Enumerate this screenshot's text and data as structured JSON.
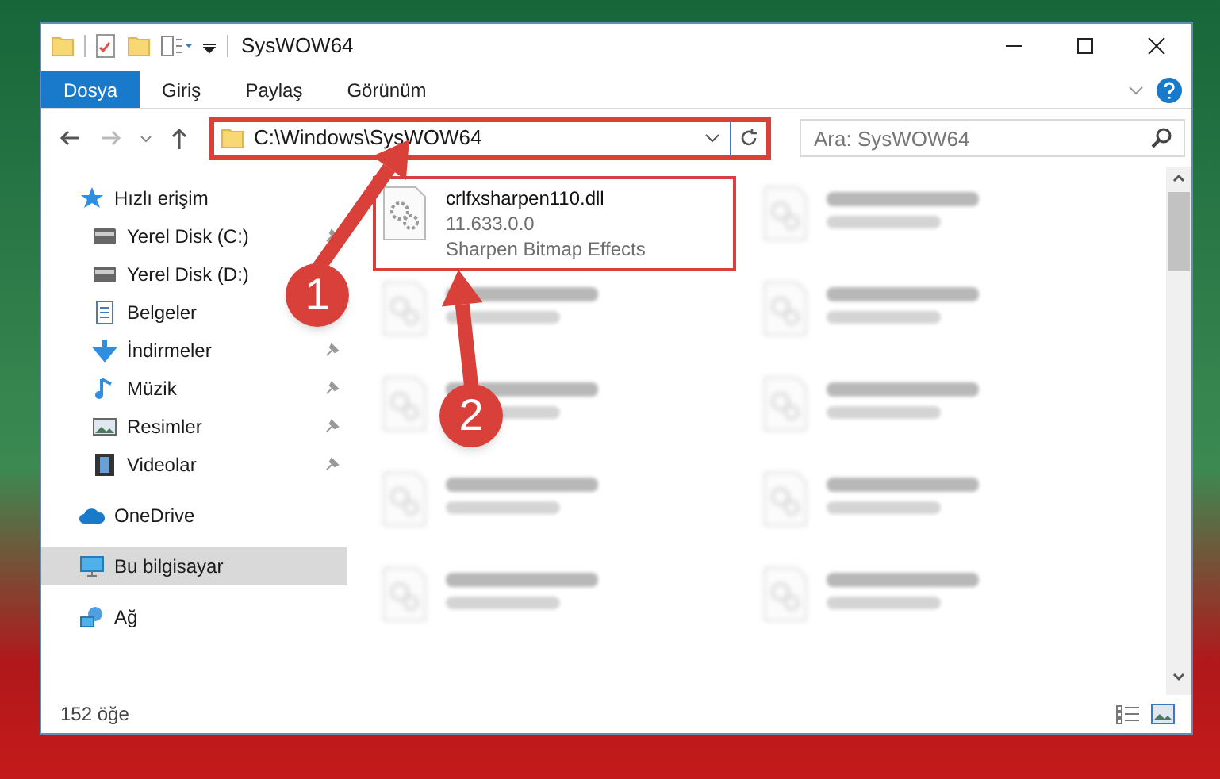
{
  "window": {
    "title": "SysWOW64"
  },
  "ribbon_tabs": [
    {
      "label": "Dosya",
      "selected": true
    },
    {
      "label": "Giriş",
      "selected": false
    },
    {
      "label": "Paylaş",
      "selected": false
    },
    {
      "label": "Görünüm",
      "selected": false
    }
  ],
  "address_bar": {
    "path": "C:\\Windows\\SysWOW64",
    "highlighted": true
  },
  "search": {
    "placeholder": "Ara: SysWOW64"
  },
  "sidebar": {
    "items": [
      {
        "label": "Hızlı erişim",
        "kind": "quick",
        "selected": false,
        "children": [
          {
            "label": "Yerel Disk (C:)",
            "kind": "disk",
            "pinned": true
          },
          {
            "label": "Yerel Disk (D:)",
            "kind": "disk"
          },
          {
            "label": "Belgeler",
            "kind": "docs"
          },
          {
            "label": "İndirmeler",
            "kind": "download",
            "pinned": true
          },
          {
            "label": "Müzik",
            "kind": "music",
            "pinned": true
          },
          {
            "label": "Resimler",
            "kind": "pictures",
            "pinned": true
          },
          {
            "label": "Videolar",
            "kind": "videos",
            "pinned": true
          }
        ]
      },
      {
        "label": "OneDrive",
        "kind": "cloud",
        "selected": false
      },
      {
        "label": "Bu bilgisayar",
        "kind": "pc",
        "selected": true
      },
      {
        "label": "Ağ",
        "kind": "network",
        "selected": false
      }
    ]
  },
  "files": [
    {
      "name": "crlfxsharpen110.dll",
      "lines": [
        "11.633.0.0",
        "Sharpen Bitmap Effects"
      ],
      "kind": "focus",
      "highlighted": true
    },
    {
      "kind": "blurred",
      "highlighted": false
    },
    {
      "kind": "blurred",
      "highlighted": false
    },
    {
      "kind": "blurred",
      "highlighted": false
    },
    {
      "kind": "blurred",
      "highlighted": false
    },
    {
      "kind": "blurred",
      "highlighted": false
    },
    {
      "kind": "blurred",
      "highlighted": false
    },
    {
      "kind": "blurred",
      "highlighted": false
    },
    {
      "kind": "blurred",
      "highlighted": false
    },
    {
      "kind": "blurred",
      "highlighted": false
    }
  ],
  "status_bar": {
    "count": "152 öğe"
  },
  "annotations": [
    {
      "number": "1"
    },
    {
      "number": "2"
    }
  ]
}
